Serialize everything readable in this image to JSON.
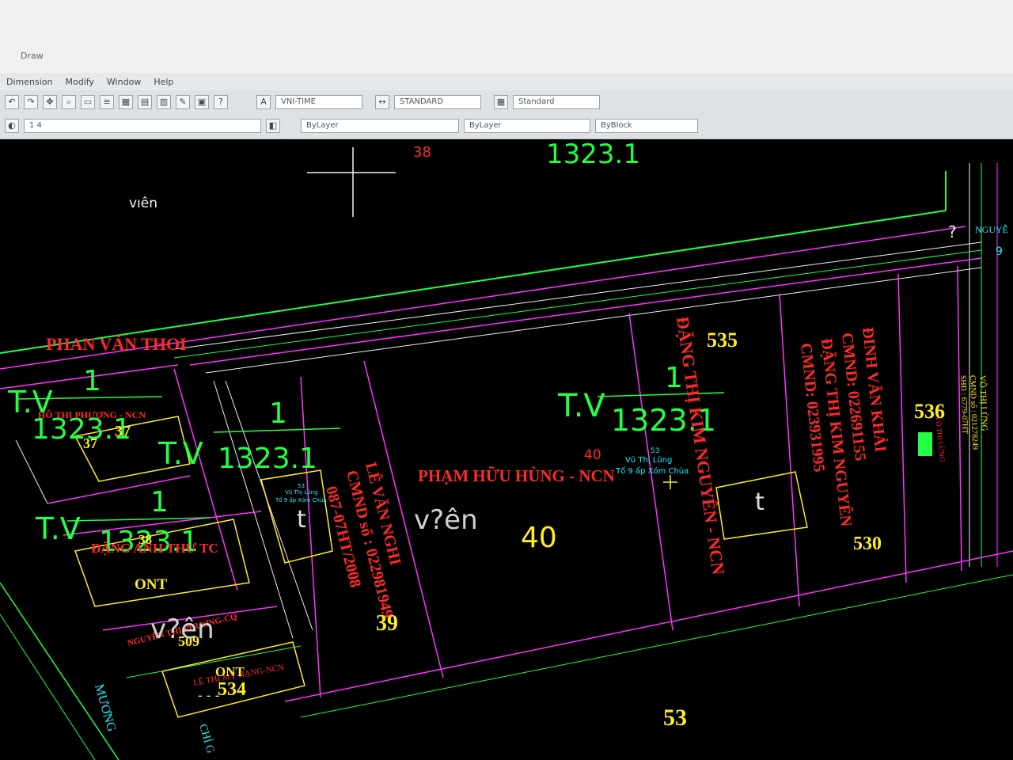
{
  "app": {
    "window_title": "Draw"
  },
  "menu": [
    "Dimension",
    "Modify",
    "Window",
    "Help"
  ],
  "toolbar": {
    "text_style": "VNI-TIME",
    "dim_style": "STANDARD",
    "table_style": "Standard",
    "layer_value": "1 4",
    "color_field": "ByLayer",
    "linetype_field": "ByLayer",
    "lineweight_field": "ByBlock"
  },
  "drawing": {
    "labels": {
      "phan_van_thoi": "PHAN VĂN THOI",
      "pham_huu_hung": "PHẠM HỮU HÙNG - NCN",
      "dang_thi_kim_nguyen_ncn": "ĐẶNG THỊ KIM NGUYÊN - NCN",
      "dinh_van_khai": "ĐINH VĂN KHẢI",
      "cmnd_khai": "CMND: 022691155",
      "dang_thi_kim_nguyen": "ĐẶNG THỊ KIM NGUYÊN",
      "cmnd_nguyen": "CMND: 023931995",
      "le_van_name": "LÊ VĂN NGHI",
      "cmnd_le": "CMND số : 022981949",
      "le_date": "087-07HT/2008",
      "dang_anh_thu": "ĐẶNG ANH THƯ TC",
      "nguyen_phuong": "NGUYỄN THỊ PHƯƠNG-CQ",
      "ho_thi_phuong": "HỒ THỊ PHƯỢNG - NCN",
      "le_ncn": "LÊ THỊ MỸ HẠNG-NCN",
      "vo_thi_lung": "VÕ THỊ LỪNG",
      "vo_cmnd": "CMND số : 021278249",
      "vo_sub": "SHĐ : 6779-07HT",
      "muong": "MƯƠNG",
      "chi": "CHỈ G",
      "nguyen_partial": "NGUYỄ",
      "vien": "v?ên",
      "vien_plain": "vıên",
      "ont": "ONT",
      "tv": "T.V",
      "fraction_top": "1",
      "fraction_bottom": "1323.1",
      "cyan_label": "Vũ Thị Lũng",
      "cyan_sub": "Tổ 9 ấp Xóm Chùa",
      "cyan_small": "53",
      "t": "t",
      "question": "?",
      "nine": "9",
      "dashes": "- - -"
    },
    "numbers": {
      "n535": "535",
      "n536": "536",
      "n530": "530",
      "n40": "40",
      "n40_small": "40",
      "n39": "39",
      "n37": "37",
      "n38": "38",
      "n509": "509",
      "n534": "534",
      "n53": "53",
      "n38_top": "38",
      "n37_b": "37"
    },
    "colors": {
      "background": "#000000",
      "magenta": "#ff33ff",
      "green": "#22ff44",
      "red": "#ff2a2a",
      "yellow": "#ffee22",
      "cyan": "#22eeff",
      "white": "#f0f0f0"
    }
  }
}
